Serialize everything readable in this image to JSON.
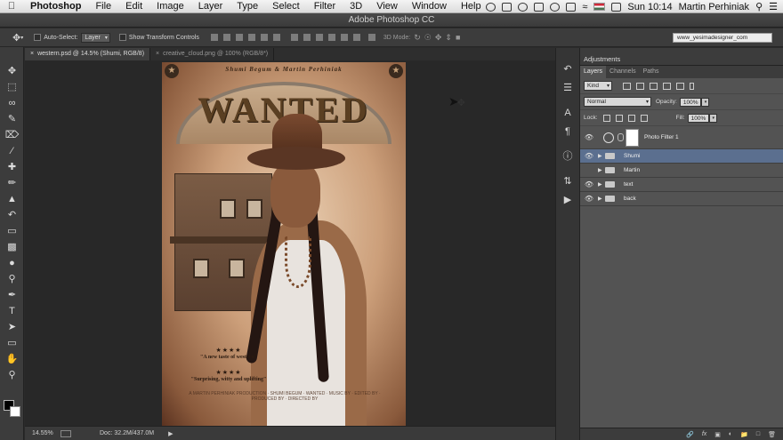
{
  "menubar": {
    "app_name": "Photoshop",
    "items": [
      "File",
      "Edit",
      "Image",
      "Layer",
      "Type",
      "Select",
      "Filter",
      "3D",
      "View",
      "Window",
      "Help"
    ],
    "clock": "Sun 10:14",
    "user": "Martin Perhiniak"
  },
  "window": {
    "title": "Adobe Photoshop CC"
  },
  "options": {
    "auto_select_label": "Auto-Select:",
    "auto_select_value": "Layer",
    "transform_label": "Show Transform Controls",
    "mode_label": "3D Mode:",
    "workspace": "www_yesimadesigner_com"
  },
  "tabs": [
    {
      "label": "western.psd @ 14.5% (Shumi, RGB/8)",
      "active": true
    },
    {
      "label": "creative_cloud.png @ 100% (RGB/8*)",
      "active": false
    }
  ],
  "poster": {
    "header": "Shumi Begum & Martin Perhiniak",
    "title": "WANTED",
    "stars": "★★★★",
    "quote1": "\"A new taste of western\"",
    "quote2": "\"Surprising, witty and uplifting\"",
    "credits": "A MARTIN PERHINIAK PRODUCTION · SHUMI BEGUM · WANTED · MUSIC BY · EDITED BY · PRODUCED BY · DIRECTED BY"
  },
  "status": {
    "zoom": "14.55%",
    "doc": "Doc: 32.2M/437.0M"
  },
  "panels": {
    "adjustments_label": "Adjustments",
    "tabs": [
      "Layers",
      "Channels",
      "Paths"
    ],
    "kind_label": "Kind",
    "blend_mode": "Normal",
    "opacity_label": "Opacity:",
    "opacity_value": "100%",
    "lock_label": "Lock:",
    "fill_label": "Fill:",
    "fill_value": "100%",
    "layers": [
      {
        "name": "Photo Filter 1",
        "visible": true,
        "type": "adjustment"
      },
      {
        "name": "Shumi",
        "visible": true,
        "type": "group",
        "selected": true
      },
      {
        "name": "Martin",
        "visible": false,
        "type": "group"
      },
      {
        "name": "text",
        "visible": true,
        "type": "group"
      },
      {
        "name": "back",
        "visible": true,
        "type": "group"
      }
    ]
  },
  "colors": {
    "selected_layer": "#5b6f8f",
    "foreground": "#000000",
    "background": "#ffffff"
  }
}
